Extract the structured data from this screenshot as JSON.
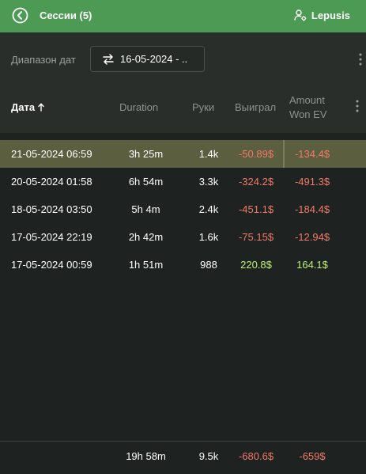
{
  "header": {
    "title": "Сессии (5)",
    "user_name": "Lepusis",
    "accent_color": "#4d9a55"
  },
  "filter": {
    "range_label": "Диапазон дат",
    "range_value": "16-05-2024 - ..",
    "range_icon": "swap-arrows-icon"
  },
  "table": {
    "columns": {
      "date": "Дата",
      "duration": "Duration",
      "hands": "Руки",
      "won": "Выиграл",
      "amount_ev_line1": "Amount",
      "amount_ev_line2": "Won EV"
    },
    "sort_column": "date",
    "rows": [
      {
        "date": "21-05-2024 06:59",
        "duration": "3h 25m",
        "hands": "1.4k",
        "won": "-50.89$",
        "ev": "-134.4$",
        "won_sign": "neg",
        "ev_sign": "neg",
        "selected": true
      },
      {
        "date": "20-05-2024 01:58",
        "duration": "6h 54m",
        "hands": "3.3k",
        "won": "-324.2$",
        "ev": "-491.3$",
        "won_sign": "neg",
        "ev_sign": "neg",
        "selected": false
      },
      {
        "date": "18-05-2024 03:50",
        "duration": "5h 4m",
        "hands": "2.4k",
        "won": "-451.1$",
        "ev": "-184.4$",
        "won_sign": "neg",
        "ev_sign": "neg",
        "selected": false
      },
      {
        "date": "17-05-2024 22:19",
        "duration": "2h 42m",
        "hands": "1.6k",
        "won": "-75.15$",
        "ev": "-12.94$",
        "won_sign": "neg",
        "ev_sign": "neg",
        "selected": false
      },
      {
        "date": "17-05-2024 00:59",
        "duration": "1h 51m",
        "hands": "988",
        "won": "220.8$",
        "ev": "164.1$",
        "won_sign": "pos",
        "ev_sign": "pos",
        "selected": false
      }
    ],
    "totals": {
      "duration": "19h 58m",
      "hands": "9.5k",
      "won": "-680.6$",
      "ev": "-659$"
    }
  },
  "colors": {
    "negative": "#f27a6a",
    "positive": "#bff07a",
    "selected_row": "#5b5e3f"
  }
}
